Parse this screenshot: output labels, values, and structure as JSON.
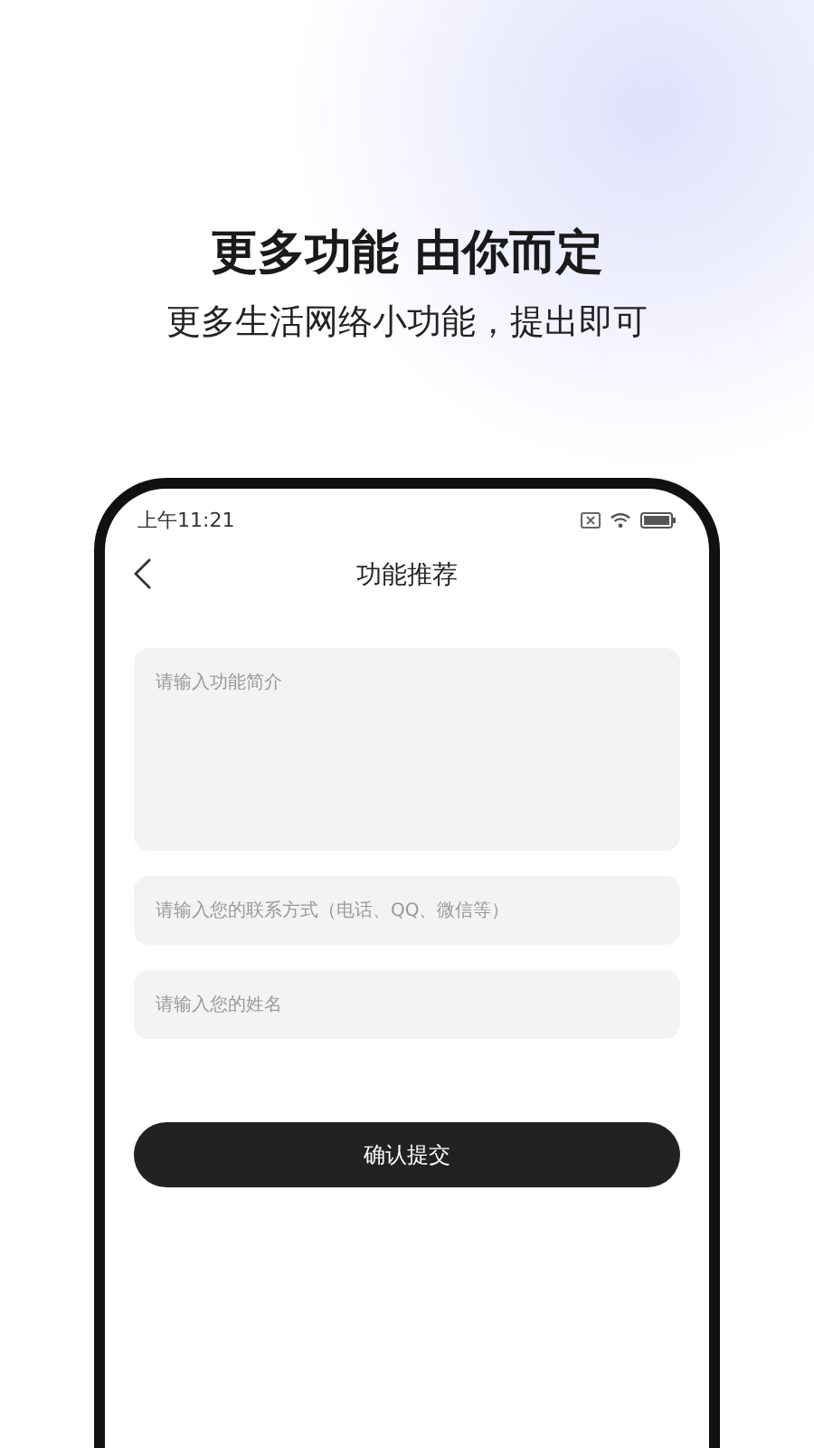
{
  "header": {
    "title": "更多功能 由你而定",
    "subtitle": "更多生活网络小功能，提出即可"
  },
  "status_bar": {
    "time": "上午11:21"
  },
  "nav": {
    "title": "功能推荐"
  },
  "fields": [
    {
      "kind": "multiline",
      "placeholder": "请输入功能简介"
    },
    {
      "kind": "single",
      "placeholder": "请输入您的联系方式（电话、QQ、微信等）"
    },
    {
      "kind": "single",
      "placeholder": "请输入您的姓名"
    }
  ],
  "submit_button": "确认提交"
}
